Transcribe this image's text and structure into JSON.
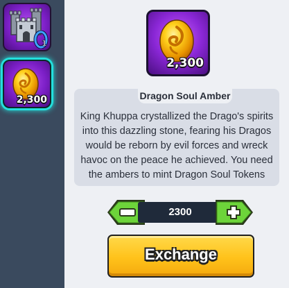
{
  "sidebar": {
    "items": [
      {
        "name": "Castle Ticket",
        "badge": "1"
      },
      {
        "name": "Dragon Soul Amber",
        "quantity": "2,300",
        "selected": true
      }
    ]
  },
  "detail": {
    "item_name": "Dragon Soul Amber",
    "quantity": "2,300",
    "description": "King Khuppa crystallized the Drago's spirits into this dazzling stone, fearing his Dragos would be reborn by evil forces and wreck havoc on the peace he achieved. You need the ambers to mint Dragon Soul Tokens"
  },
  "stepper": {
    "value": "2300",
    "minus_icon": "minus-icon",
    "plus_icon": "plus-icon"
  },
  "exchange": {
    "label": "Exchange"
  },
  "colors": {
    "sidebar_bg": "#3a4a5e",
    "panel_bg": "#eef0f4",
    "card_bg": "#d9dde6",
    "slot_purple": "#7c1fc7",
    "selection_cyan": "#23e0dd",
    "stepper_green": "#6dd43a",
    "button_yellow": "#ffc21a"
  }
}
